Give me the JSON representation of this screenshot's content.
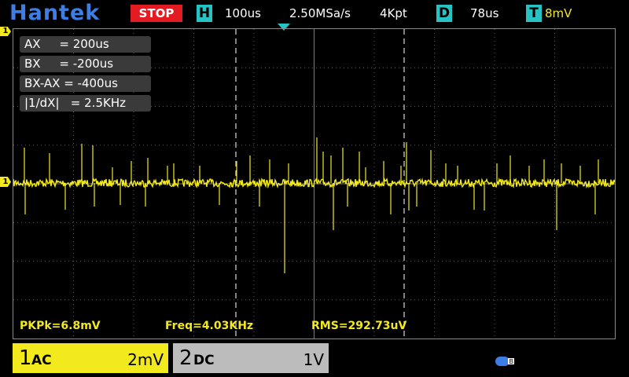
{
  "header": {
    "brand": "Hantek",
    "run_state": "STOP",
    "horizontal": {
      "key": "H",
      "timebase": "100us",
      "sample_rate": "2.50MSa/s",
      "memory_depth": "4Kpt"
    },
    "delay": {
      "key": "D",
      "value": "78us"
    },
    "trigger": {
      "key": "T",
      "level": "8mV"
    }
  },
  "cursors": {
    "rows": [
      {
        "label": "AX",
        "text": "AX     = 200us"
      },
      {
        "label": "BX",
        "text": "BX     = -200us"
      },
      {
        "label": "BX-AX",
        "text": "BX-AX = -400us"
      },
      {
        "label": "|1/dX|",
        "text": "|1/dX|   = 2.5KHz"
      }
    ]
  },
  "markers": {
    "trigger_level_channel": "1",
    "channel1_ground": "1"
  },
  "measurements": {
    "pkpk": "PKPk=6.8mV",
    "freq": "Freq=4.03KHz",
    "rms": "RMS=292.73uV"
  },
  "channels": [
    {
      "number": "1",
      "coupling": "AC",
      "scale": "2mV",
      "color": "#f3ea1d"
    },
    {
      "number": "2",
      "coupling": "DC",
      "scale": "1V",
      "color": "#bcbcbc"
    }
  ],
  "colors": {
    "trace": "#f3ea1d",
    "accent": "#27c2c4",
    "stop": "#e31b23",
    "brand": "#3d7ee6"
  },
  "icons": {
    "usb": "usb-icon"
  }
}
